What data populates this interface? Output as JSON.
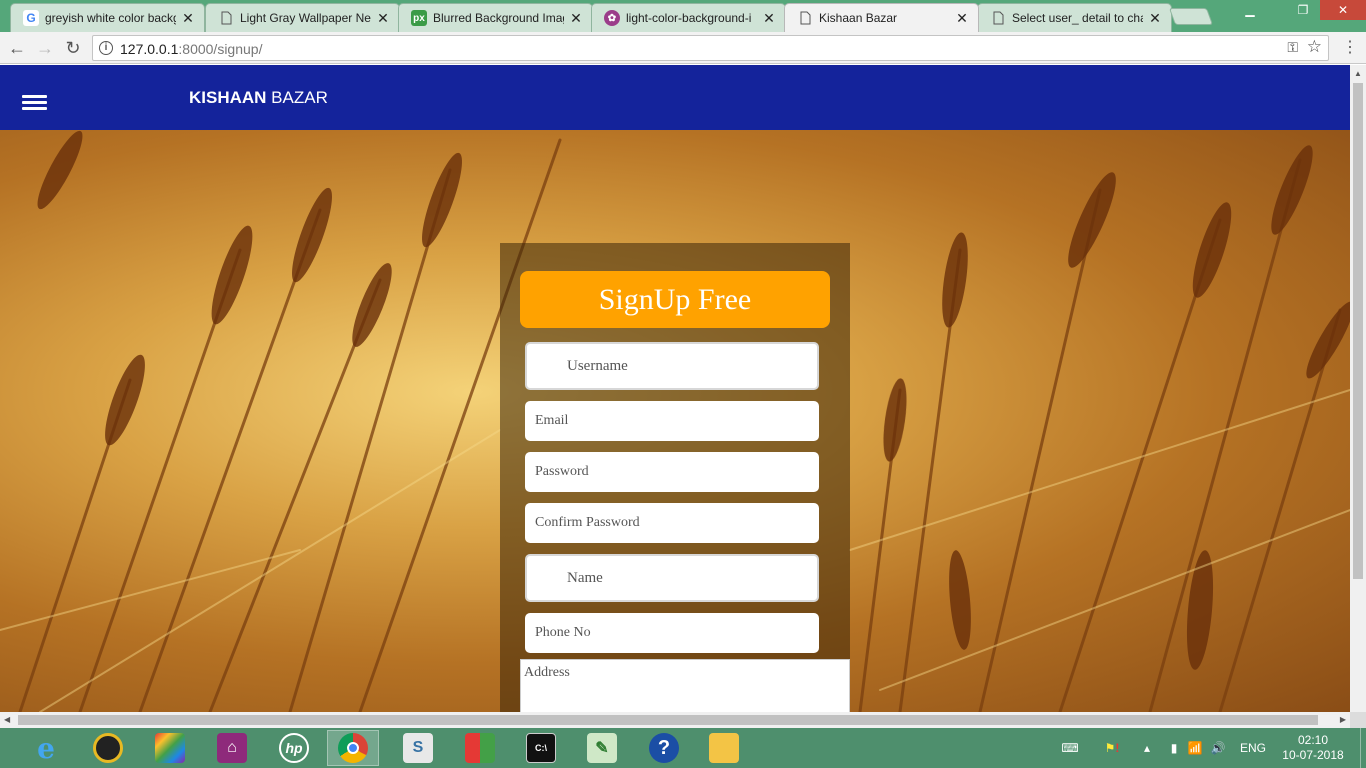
{
  "browser": {
    "tabs": [
      {
        "title": "greyish white color backg",
        "favicon": "google-icon",
        "active": false
      },
      {
        "title": "Light Gray Wallpaper Ne",
        "favicon": "page-icon",
        "active": false
      },
      {
        "title": "Blurred Background Imag",
        "favicon": "px-icon",
        "active": false
      },
      {
        "title": "light-color-background-i",
        "favicon": "pinwheel-icon",
        "active": false
      },
      {
        "title": "Kishaan Bazar",
        "favicon": "page-icon",
        "active": true
      },
      {
        "title": "Select user_ detail to char",
        "favicon": "page-icon",
        "active": false
      }
    ],
    "favicon_px": "px",
    "url_host": "127.0.0.1",
    "url_rest": ":8000/signup/"
  },
  "site": {
    "brand_bold": "KISHAAN",
    "brand_rest": " BAZAR"
  },
  "form": {
    "heading": "SignUp Free",
    "username": "Username",
    "email": "Email",
    "password": "Password",
    "confirm_password": "Confirm Password",
    "name": "Name",
    "phone": "Phone No",
    "address": "Address",
    "accent_color": "#ffa200",
    "nav_color": "#14239b"
  },
  "taskbar": {
    "apps": [
      "internet-explorer-icon",
      "media-player-icon",
      "paint-app-icon",
      "projector-app-icon",
      "hp-icon",
      "chrome-icon",
      "python-file-icon",
      "colors-app-icon",
      "command-prompt-icon",
      "notepad-icon",
      "help-icon",
      "file-explorer-icon"
    ],
    "hp_label": "hp",
    "help_label": "?",
    "cmd_label": "C:\\",
    "language": "ENG",
    "time": "02:10",
    "date": "10-07-2018"
  }
}
